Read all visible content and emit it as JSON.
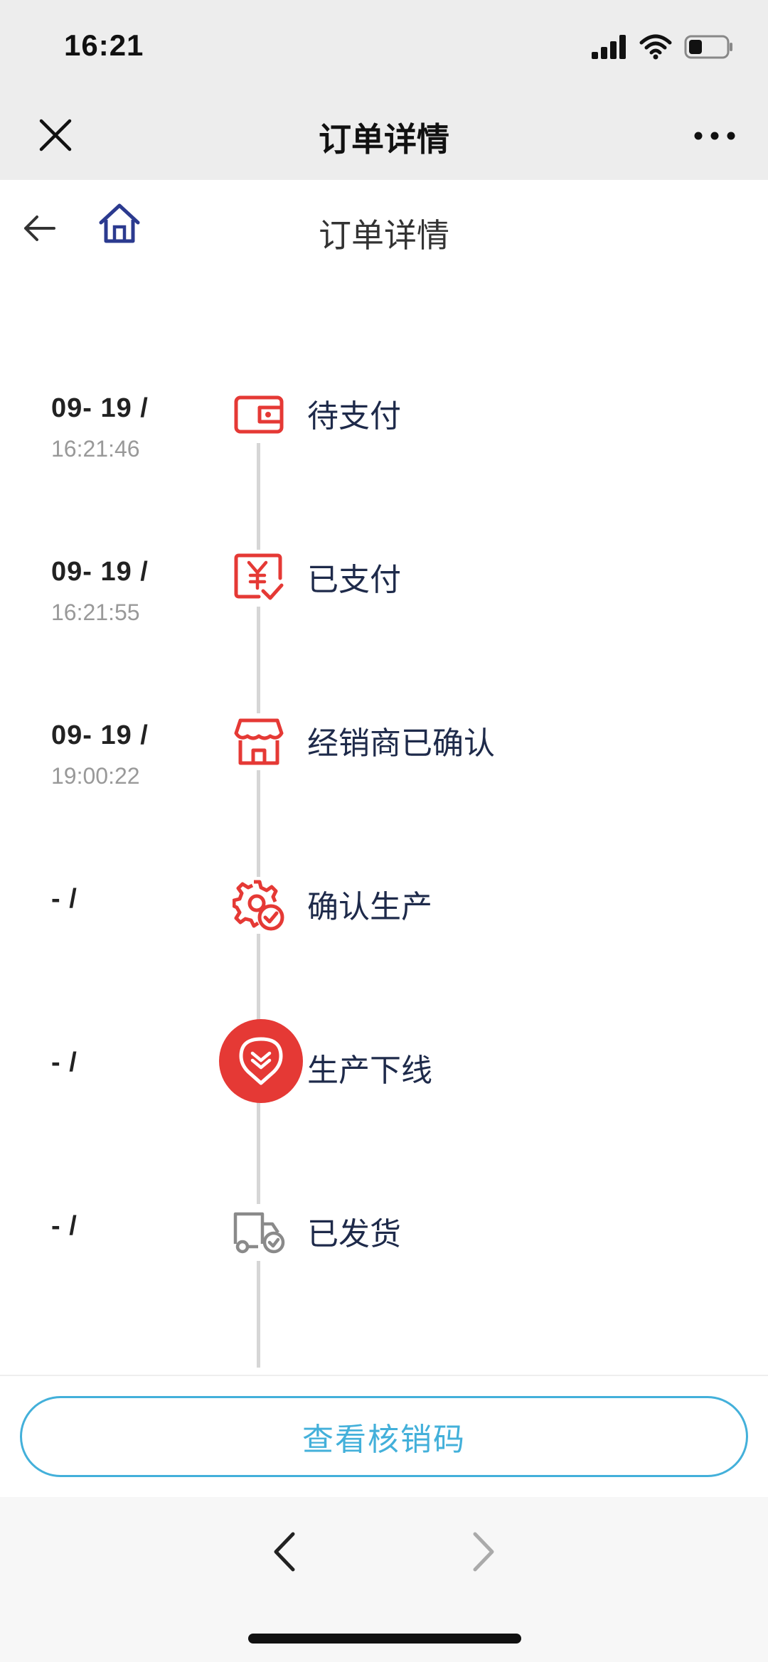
{
  "status_bar": {
    "time": "16:21"
  },
  "wechat_bar": {
    "title": "订单详情"
  },
  "page_header": {
    "title": "订单详情"
  },
  "timeline": {
    "items": [
      {
        "date": "09- 19 /",
        "time": "16:21:46",
        "label": "待支付",
        "icon": "wallet-icon"
      },
      {
        "date": "09- 19 /",
        "time": "16:21:55",
        "label": "已支付",
        "icon": "yuan-check-icon"
      },
      {
        "date": "09- 19 /",
        "time": "19:00:22",
        "label": "经销商已确认",
        "icon": "store-icon"
      },
      {
        "date": "- /",
        "time": "",
        "label": "确认生产",
        "icon": "gear-check-icon"
      },
      {
        "date": "- /",
        "time": "",
        "label": "生产下线",
        "icon": "location-down-icon",
        "active": true
      },
      {
        "date": "- /",
        "time": "",
        "label": "已发货",
        "icon": "truck-check-icon"
      }
    ]
  },
  "bottom_action": {
    "verify_label": "查看核销码"
  },
  "colors": {
    "accent_red": "#e53935",
    "accent_blue": "#43b0da",
    "home_icon": "#2b3a8f"
  }
}
